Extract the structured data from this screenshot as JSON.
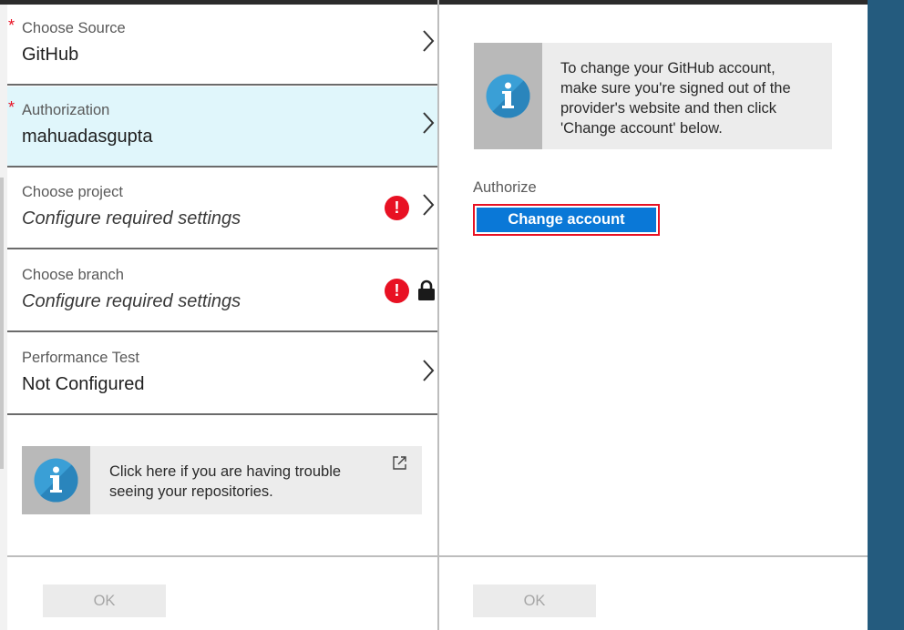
{
  "left_blade": {
    "items": [
      {
        "required": "*",
        "label": "Choose Source",
        "value": "GitHub"
      },
      {
        "required": "*",
        "label": "Authorization",
        "value": "mahuadasgupta"
      },
      {
        "label": "Choose project",
        "value": "Configure required settings"
      },
      {
        "label": "Choose branch",
        "value": "Configure required settings"
      },
      {
        "label": "Performance Test",
        "value": "Not Configured"
      }
    ],
    "error_glyph": "!",
    "info": {
      "text_line1": "Click here if you are having trouble",
      "text_line2": "seeing your repositories.",
      "icon": "info-icon"
    },
    "ok_label": "OK"
  },
  "right_blade": {
    "info": {
      "line1": "To change your GitHub account,",
      "line2": "make sure you're signed out of the",
      "line3": "provider's website and then click",
      "line4": "'Change account' below.",
      "icon": "info-icon"
    },
    "authorize_label": "Authorize",
    "change_account_label": "Change account",
    "ok_label": "OK"
  },
  "colors": {
    "selected_bg": "#e0f6fb",
    "error": "#e81123",
    "primary_button": "#0a78d7",
    "info_icon": "#3a9fd6",
    "portal_bg": "#245b7e"
  }
}
